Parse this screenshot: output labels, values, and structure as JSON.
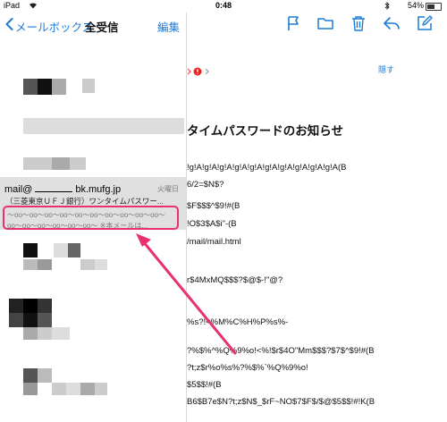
{
  "status_bar": {
    "device": "iPad",
    "time": "0:48",
    "battery": "54%"
  },
  "nav": {
    "back_label": "メールボックス",
    "title": "全受信",
    "edit_label": "編集"
  },
  "selected_mail": {
    "sender_prefix": "mail@",
    "sender_suffix": "bk.mufg.jp",
    "day": "火曜日",
    "subject": "（三菱東京ＵＦＪ銀行）ワンタイムパスワー...",
    "preview_line1": "〜oo〜oo〜oo〜oo〜oo〜oo〜oo〜oo〜oo〜oo〜",
    "preview_line2": "oo〜oo〜oo〜oo〜oo〜oo〜 ※本メールは..."
  },
  "detail": {
    "hide_label": "隠す",
    "title": "タイムパスワードのお知らせ",
    "body_lines": [
      "!g!A!g!A!g!A!g!A!g!A!g!A!g!A!g!A!g!A!g!A(B",
      "6/2=$N$?",
      "$F$$$^$9!#(B",
      "!O$3$A$i\"-(B",
      "/mail/mail.html",
      "r$4MxMQ$$$?$@$-!\"@?",
      "%s?!<%M%C%H%P%s%-",
      "?%$%^%Q%9%o!<%!$r$4O\"Mm$$$?$7$^$9!#(B",
      "?t;z$r%o%s%?%$%`%Q%9%o!",
      "$5$$!#(B",
      "B6$B7e$N?t;z$N$_$rF~NO$7$F$/$@$5$$!#!K(B"
    ]
  },
  "colors": {
    "accent": "#1a7bd9",
    "highlight": "#e8316e",
    "selected_row": "#e0e0e0"
  },
  "icons": [
    "back-chevron-icon",
    "flag-icon",
    "folder-icon",
    "trash-icon",
    "reply-icon",
    "compose-icon",
    "wifi-icon",
    "battery-icon",
    "bluetooth-icon"
  ]
}
